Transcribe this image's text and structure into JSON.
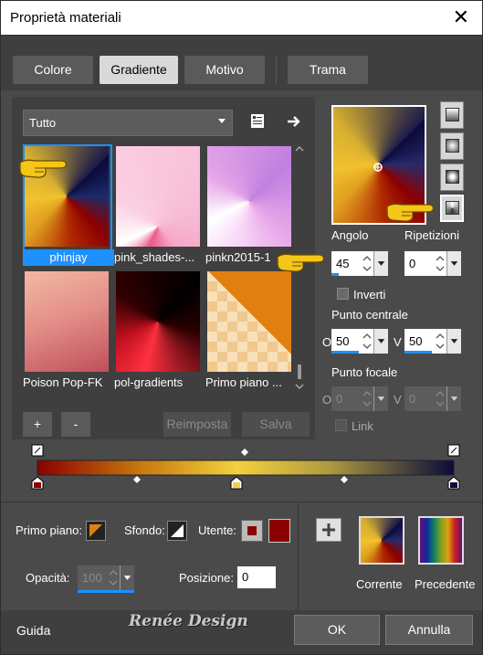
{
  "window": {
    "title": "Proprietà materiali",
    "close_glyph": "✕"
  },
  "tabs": [
    {
      "label": "Colore",
      "active": false
    },
    {
      "label": "Gradiente",
      "active": true
    },
    {
      "label": "Motivo",
      "active": false
    },
    {
      "label": "Trama",
      "active": false
    }
  ],
  "library": {
    "category": "Tutto",
    "items": [
      {
        "label": "phinjay",
        "selected": true
      },
      {
        "label": "pink_shades-...",
        "selected": false
      },
      {
        "label": "pinkn2015-1",
        "selected": false
      },
      {
        "label": "Poison Pop-FK",
        "selected": false
      },
      {
        "label": "pol-gradients",
        "selected": false
      },
      {
        "label": "Primo piano ...",
        "selected": false
      }
    ],
    "add_label": "+",
    "remove_label": "-",
    "reset_label": "Reimposta",
    "save_label": "Salva"
  },
  "gradient_settings": {
    "angle_label": "Angolo",
    "angle_value": "45",
    "repeat_label": "Ripetizioni",
    "repeat_value": "0",
    "invert_label": "Inverti",
    "center_label": "Punto centrale",
    "center_h_axis": "O",
    "center_h_value": "50",
    "center_v_axis": "V",
    "center_v_value": "50",
    "focal_label": "Punto focale",
    "focal_h_axis": "O",
    "focal_h_value": "0",
    "focal_v_axis": "V",
    "focal_v_value": "0",
    "link_label": "Link"
  },
  "bottom": {
    "foreground_label": "Primo piano:",
    "background_label": "Sfondo:",
    "user_label": "Utente:",
    "user_color": "#8b0000",
    "opacity_label": "Opacità:",
    "opacity_value": "100",
    "position_label": "Posizione:",
    "position_value": "0",
    "current_label": "Corrente",
    "previous_label": "Precedente",
    "watermark": "Renée Design"
  },
  "footer": {
    "help_label": "Guida",
    "ok_label": "OK",
    "cancel_label": "Annulla"
  },
  "colors": {
    "accent": "#1e90ff",
    "dark_red": "#8b0000",
    "gold": "#f2c12e",
    "navy": "#0a0a3a"
  }
}
